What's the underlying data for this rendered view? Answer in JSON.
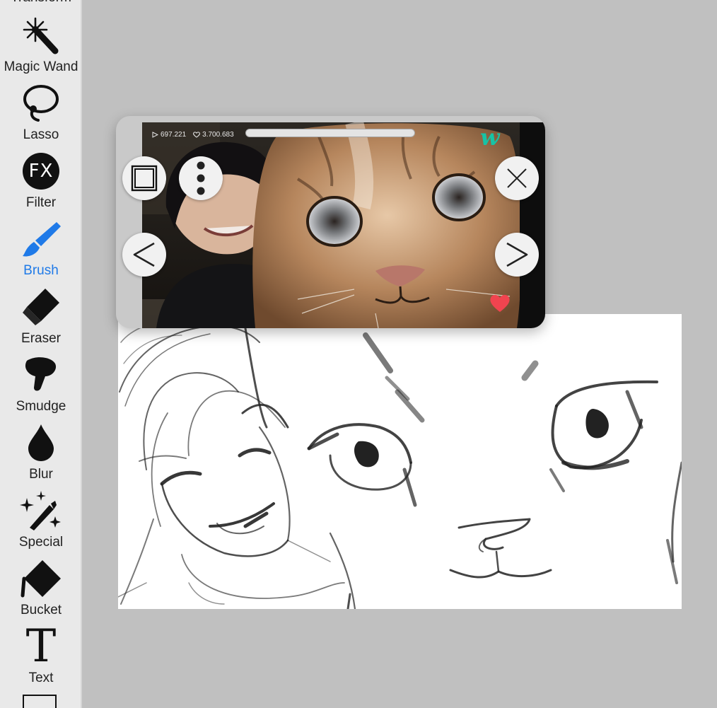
{
  "toolbar": {
    "partial_top_label": "Transform",
    "tools": [
      {
        "label": "Magic Wand",
        "icon": "magic-wand-icon"
      },
      {
        "label": "Lasso",
        "icon": "lasso-icon"
      },
      {
        "label": "Filter",
        "icon": "fx-icon",
        "icon_text": "FX"
      },
      {
        "label": "Brush",
        "icon": "brush-icon",
        "active": true
      },
      {
        "label": "Eraser",
        "icon": "eraser-icon"
      },
      {
        "label": "Smudge",
        "icon": "smudge-icon"
      },
      {
        "label": "Blur",
        "icon": "blur-drop-icon"
      },
      {
        "label": "Special",
        "icon": "special-sparkle-icon"
      },
      {
        "label": "Bucket",
        "icon": "bucket-icon"
      },
      {
        "label": "Text",
        "icon": "text-icon",
        "icon_text": "T"
      }
    ],
    "active_color": "#1f7ae8"
  },
  "reference_window": {
    "stats": {
      "plays": "697.221",
      "likes": "3.700.683"
    },
    "brand_logo_text": "w",
    "brand_color": "#17c3a5",
    "heart_color": "#f0444f",
    "controls": {
      "fullscreen": "square-frame-icon",
      "more": "vertical-dots-icon",
      "close": "close-x-icon",
      "previous": "chevron-left-icon",
      "next": "chevron-right-icon"
    }
  }
}
